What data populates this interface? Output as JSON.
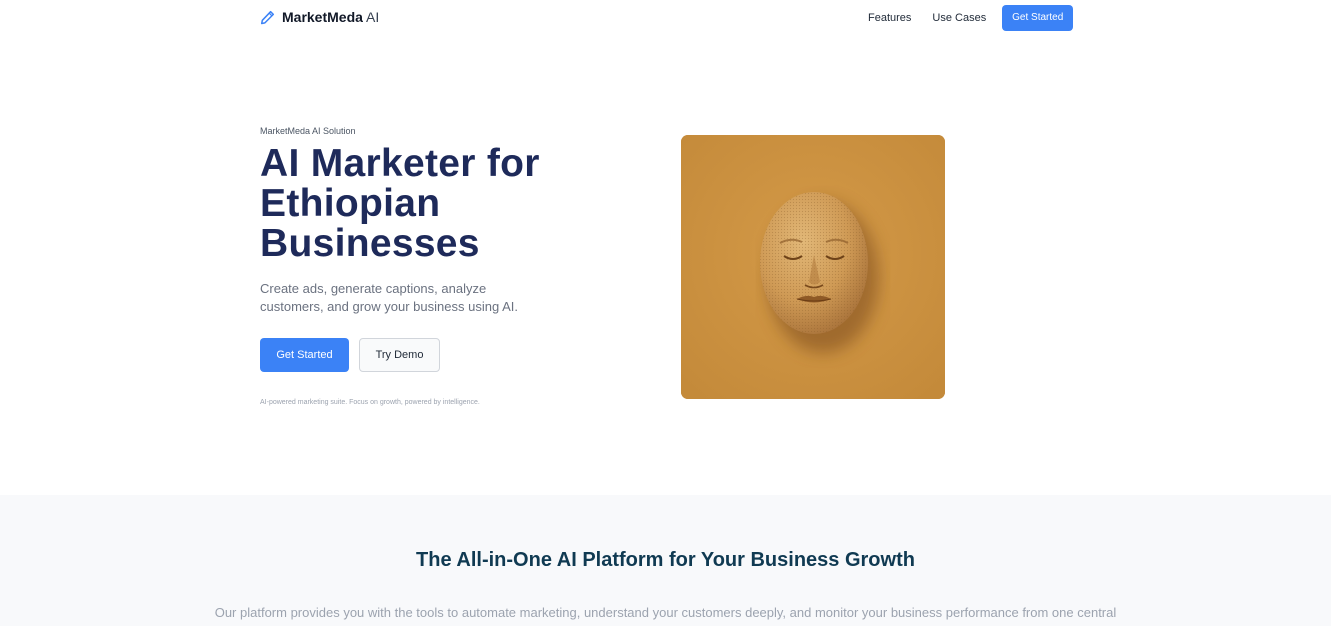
{
  "nav": {
    "brand_bold": "MarketMeda",
    "brand_light": "AI",
    "links": [
      "Features",
      "Use Cases"
    ],
    "cta_label": "Get Started"
  },
  "hero": {
    "eyebrow": "MarketMeda AI Solution",
    "headline": "AI Marketer for Ethiopian Businesses",
    "subtext": "Create ads, generate captions, analyze customers, and grow your business using AI.",
    "primary_button": "Get Started",
    "secondary_button": "Try Demo",
    "note": "AI-powered marketing suite. Focus on growth, powered by intelligence."
  },
  "platform": {
    "title": "The All-in-One AI Platform for Your Business Growth",
    "description": "Our platform provides you with the tools to automate marketing, understand your customers deeply, and monitor your business performance from one central"
  },
  "colors": {
    "accent": "#3b82f6",
    "headline": "#1e2a5a",
    "section_title": "#103a52",
    "image_background": "#c98f3f"
  },
  "icons": {
    "brand": "pencil-icon",
    "hero_image": "carved-face-mask-illustration"
  }
}
